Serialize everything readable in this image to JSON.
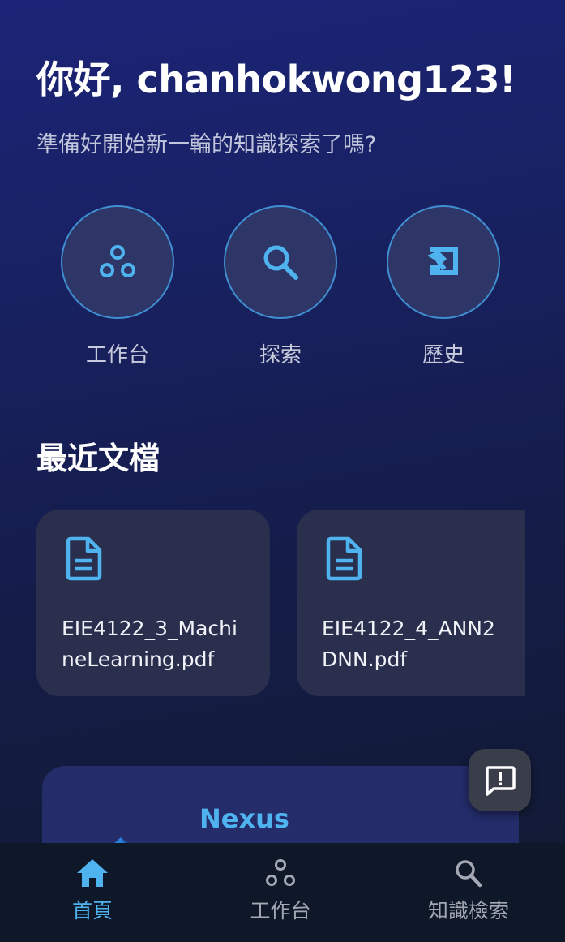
{
  "header": {
    "greeting": "你好, chanhokwong123!",
    "subtitle": "準備好開始新一輪的知識探索了嗎?"
  },
  "quick_actions": [
    {
      "label": "工作台",
      "icon": "workspace-icon"
    },
    {
      "label": "探索",
      "icon": "search-icon"
    },
    {
      "label": "歷史",
      "icon": "history-icon"
    }
  ],
  "recent": {
    "title": "最近文檔",
    "documents": [
      {
        "name": "EIE4122_3_MachineLearning.pdf",
        "icon": "document-icon"
      },
      {
        "name": "EIE4122_4_ANN2DNN.pdf",
        "icon": "document-icon"
      }
    ]
  },
  "promo": {
    "title": "Nexus"
  },
  "fab": {
    "icon": "feedback-icon"
  },
  "bottom_nav": {
    "items": [
      {
        "label": "首頁",
        "icon": "home-icon",
        "active": true
      },
      {
        "label": "工作台",
        "icon": "workspace-icon",
        "active": false
      },
      {
        "label": "知識檢索",
        "icon": "search-icon",
        "active": false
      }
    ]
  },
  "colors": {
    "accent": "#4fb3f0",
    "background_top": "#1c2478",
    "background_bottom": "#111a30",
    "card": "#2a2f4e",
    "nav_background": "#0e1828"
  }
}
